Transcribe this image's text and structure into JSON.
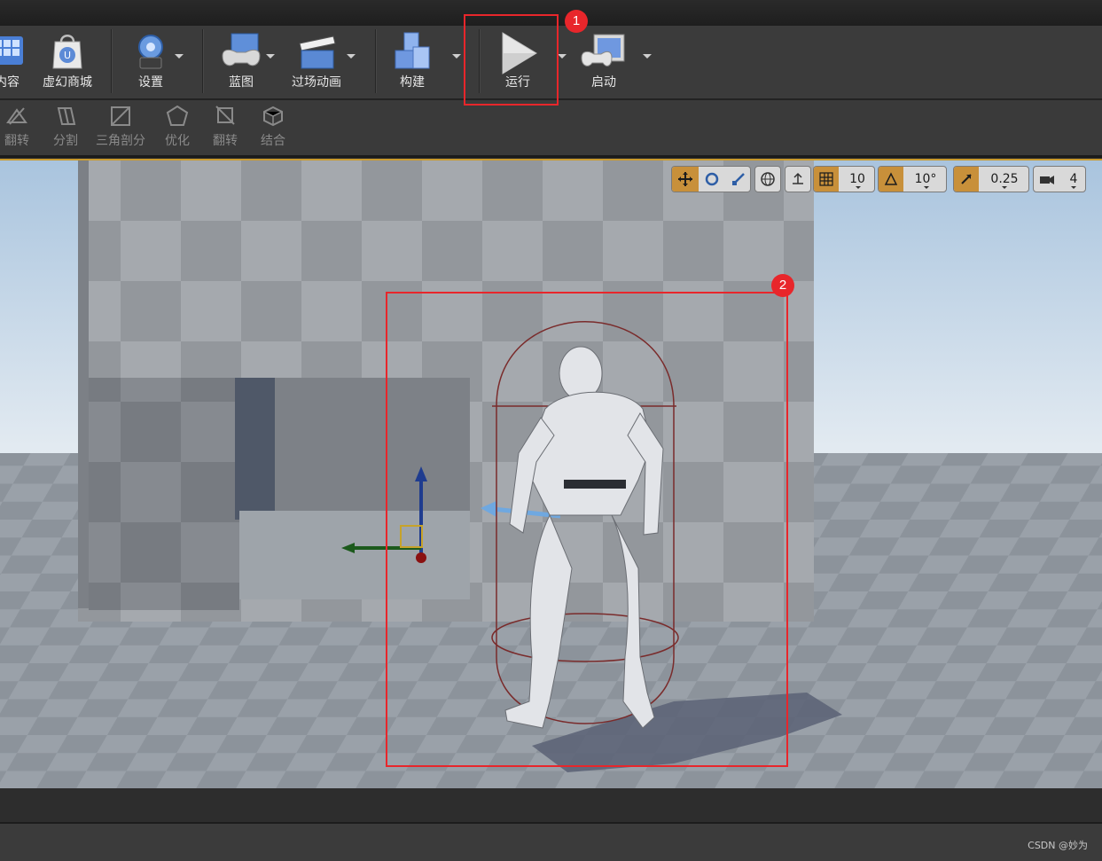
{
  "toolbar": {
    "items": [
      {
        "label": "内容"
      },
      {
        "label": "虚幻商城"
      },
      {
        "label": "设置"
      },
      {
        "label": "蓝图"
      },
      {
        "label": "过场动画"
      },
      {
        "label": "构建"
      },
      {
        "label": "运行"
      },
      {
        "label": "启动"
      }
    ],
    "play_icon": "play-icon",
    "launch_icon": "launch-icon"
  },
  "geometry_bar": {
    "items": [
      {
        "label": "翻转",
        "icon": "flip-icon"
      },
      {
        "label": "分割",
        "icon": "split-icon"
      },
      {
        "label": "三角剖分",
        "icon": "triangulate-icon"
      },
      {
        "label": "优化",
        "icon": "optimize-icon"
      },
      {
        "label": "翻转",
        "icon": "flip-icon"
      },
      {
        "label": "结合",
        "icon": "merge-icon"
      }
    ]
  },
  "viewport_toolbar": {
    "grid_snap": "10",
    "rotation_snap": "10°",
    "scale_snap": "0.25",
    "camera_speed": "4",
    "colors": {
      "accent": "#c8903a",
      "selection": "#c99a2e"
    }
  },
  "annotations": [
    {
      "number": "1",
      "color": "#e8262b"
    },
    {
      "number": "2",
      "color": "#e8262b"
    }
  ],
  "watermark": "CSDN @妙为"
}
